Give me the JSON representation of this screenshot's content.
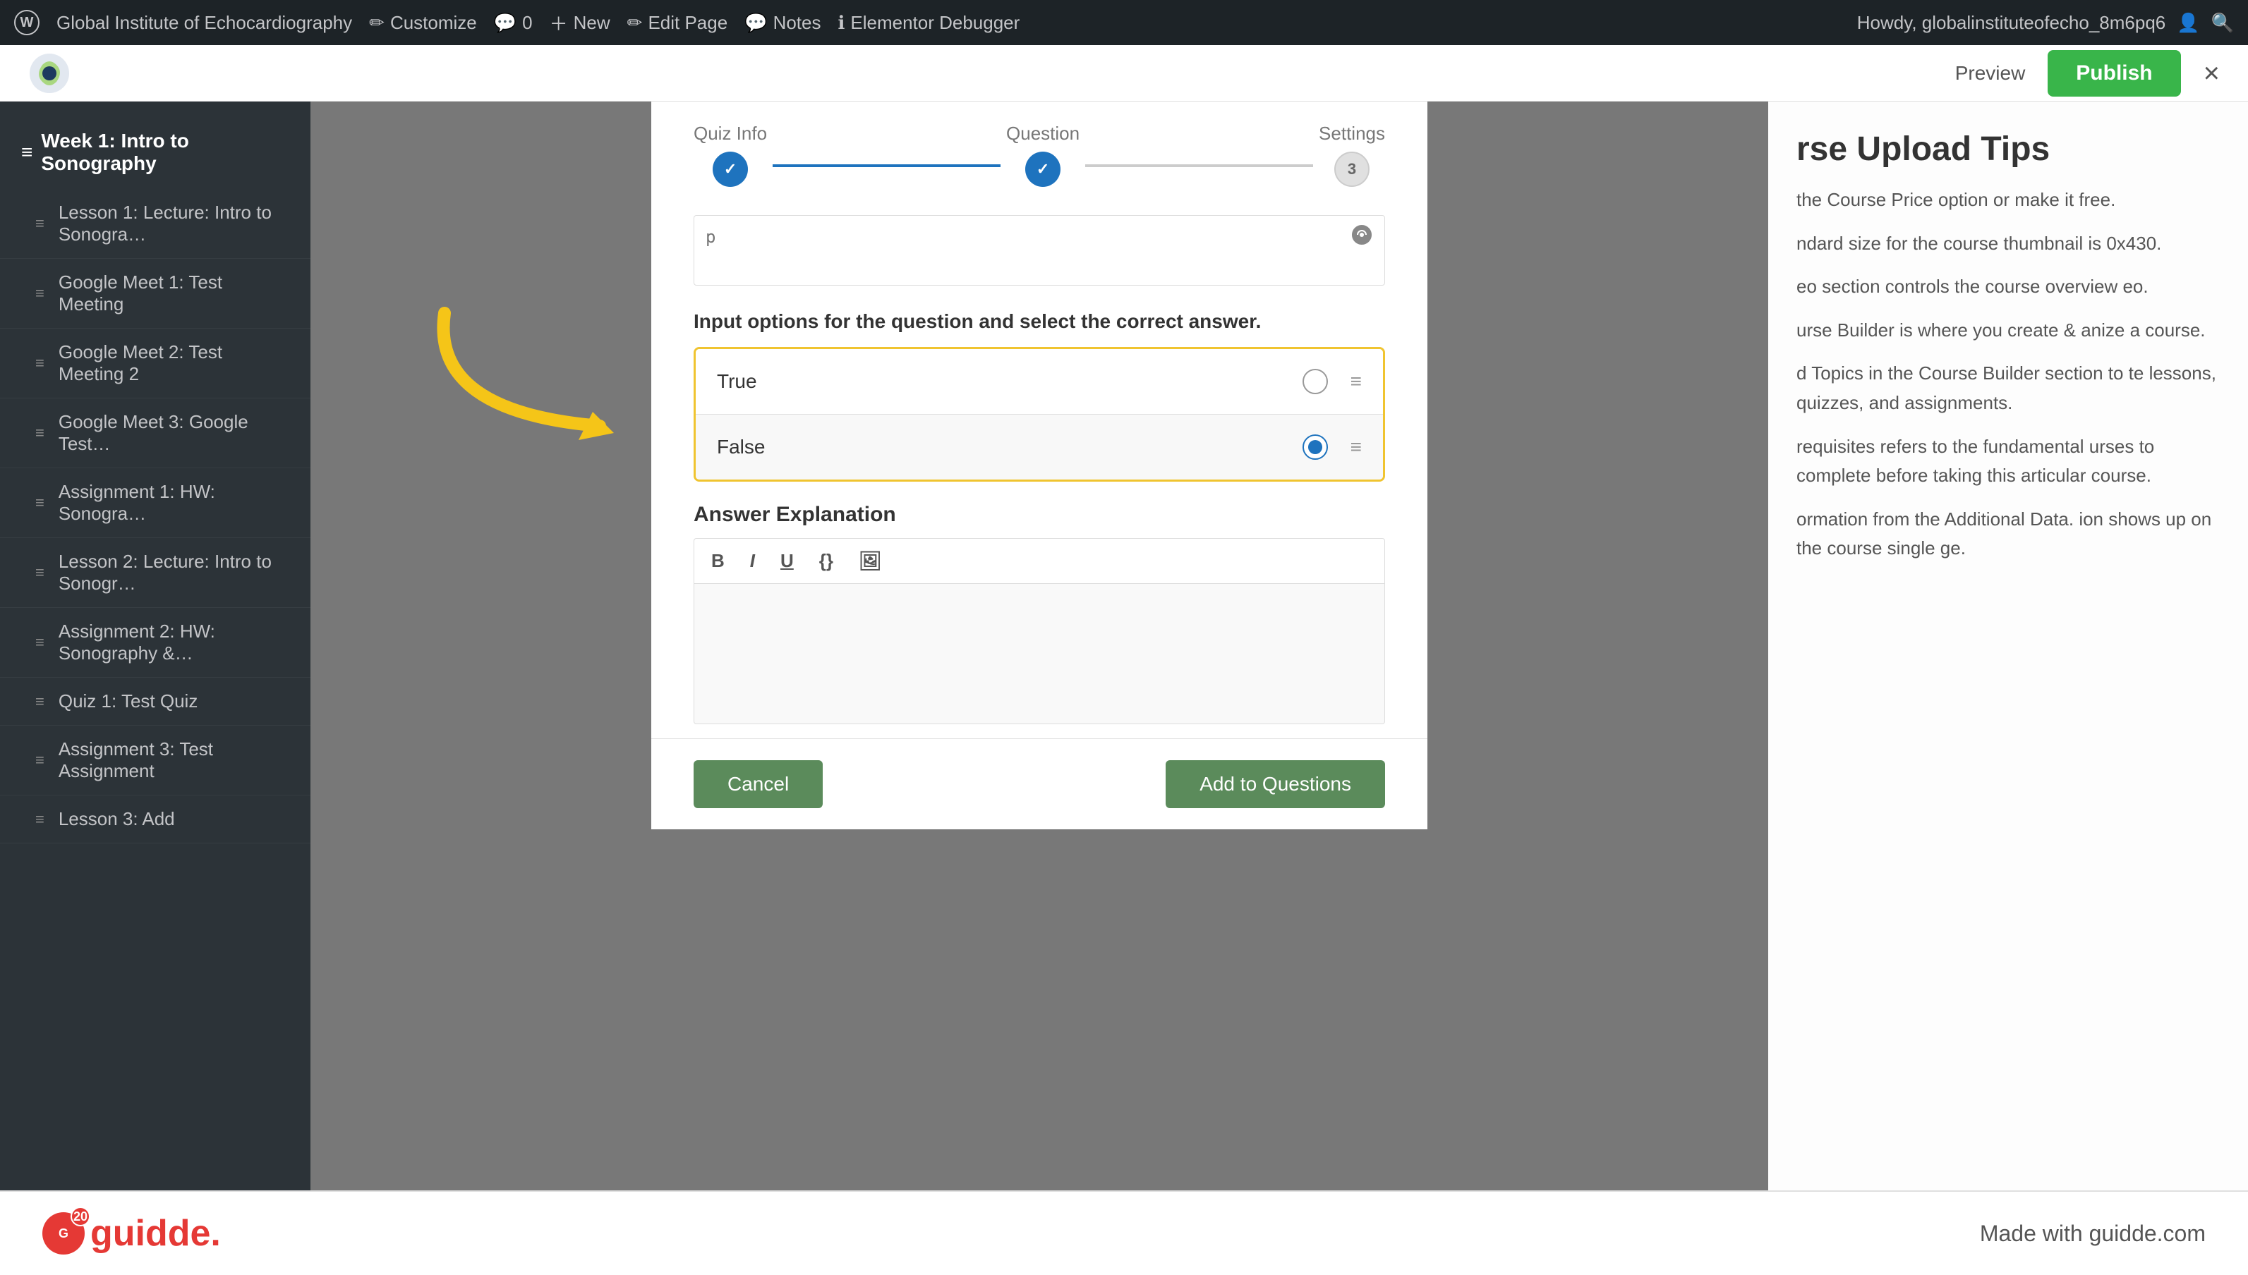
{
  "adminBar": {
    "site": "Global Institute of Echocardiography",
    "items": [
      {
        "label": "Customize",
        "icon": "edit"
      },
      {
        "label": "0",
        "icon": "comment"
      },
      {
        "label": "New",
        "icon": "plus"
      },
      {
        "label": "Edit Page",
        "icon": "edit"
      },
      {
        "label": "Notes",
        "icon": "note"
      },
      {
        "label": "Elementor Debugger",
        "icon": "info"
      }
    ],
    "userLabel": "Howdy, globalinstituteofecho_8m6pq6"
  },
  "topBar": {
    "preview": "Preview",
    "publish": "Publish",
    "close": "×"
  },
  "sidebar": {
    "sectionTitle": "Week 1: Intro to Sonography",
    "items": [
      "Lesson 1: Lecture: Intro to Sonogra…",
      "Google Meet 1: Test Meeting",
      "Google Meet 2: Test Meeting 2",
      "Google Meet 3: Google Test…",
      "Assignment 1: HW: Sonogra…",
      "Lesson 2: Lecture: Intro to Sonogr…",
      "Assignment 2: HW: Sonography &…",
      "Quiz 1: Test Quiz",
      "Assignment 3: Test Assignment",
      "Lesson 3: Add"
    ]
  },
  "quizModal": {
    "steps": [
      {
        "label": "Quiz Info",
        "state": "done"
      },
      {
        "label": "Question",
        "state": "done"
      },
      {
        "label": "Settings",
        "number": "3",
        "state": "todo"
      }
    ],
    "questionPlaceholder": "p",
    "optionsInstruction": "Input options for the question and select the correct answer.",
    "options": [
      {
        "text": "True",
        "selected": false
      },
      {
        "text": "False",
        "selected": true
      }
    ],
    "answerExplanation": {
      "title": "Answer Explanation",
      "toolbarButtons": [
        "B",
        "I",
        "U",
        "{}",
        "🖼"
      ]
    },
    "cancelButton": "Cancel",
    "addButton": "Add to Questions"
  },
  "rightSidebar": {
    "title": "rse Upload Tips",
    "paragraphs": [
      "the Course Price option or make it free.",
      "ndard size for the course thumbnail is 0x430.",
      "eo section controls the course overview eo.",
      "urse Builder is where you create & anize a course.",
      "d Topics in the Course Builder section to te lessons, quizzes, and assignments.",
      "requisites refers to the fundamental urses to complete before taking this articular course.",
      "ormation from the Additional Data. ion shows up on the course single ge."
    ]
  },
  "bottomBar": {
    "logoText": "guidde.",
    "badge": "20",
    "madeWith": "Made with guidde.com"
  }
}
